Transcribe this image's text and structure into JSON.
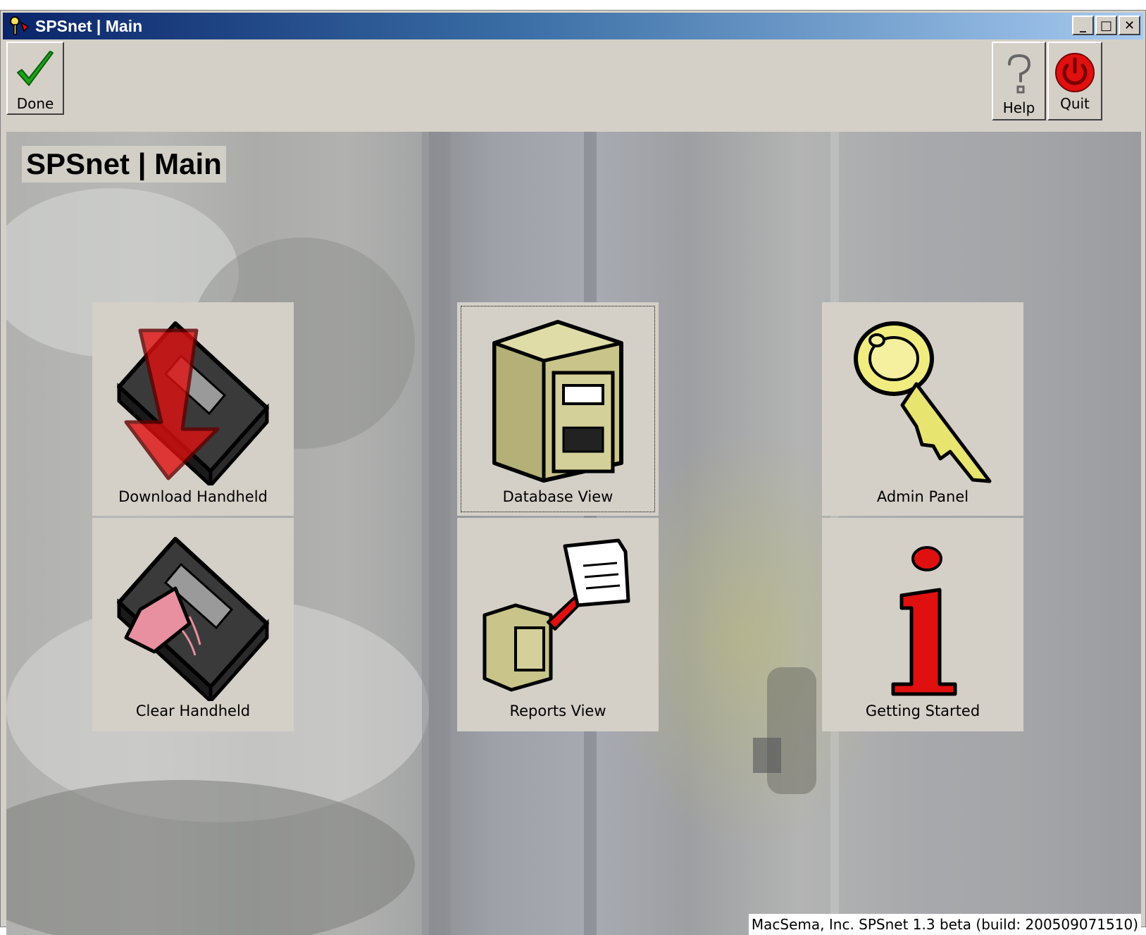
{
  "window": {
    "title": "SPSnet | Main",
    "controls": {
      "minimize": "_",
      "maximize": "□",
      "close": "✕"
    }
  },
  "toolbar": {
    "done_label": "Done",
    "help_label": "Help",
    "quit_label": "Quit"
  },
  "main": {
    "page_title": "SPSnet | Main",
    "tiles": [
      {
        "label": "Download Handheld",
        "icon": "download-handheld-icon"
      },
      {
        "label": "Clear Handheld",
        "icon": "clear-handheld-icon"
      },
      {
        "label": "Database View",
        "icon": "filing-cabinet-icon",
        "focused": true
      },
      {
        "label": "Reports View",
        "icon": "reports-icon"
      },
      {
        "label": "Admin Panel",
        "icon": "key-icon"
      },
      {
        "label": "Getting Started",
        "icon": "info-icon"
      }
    ]
  },
  "status_bar": {
    "text": "MacSema, Inc. SPSnet 1.3 beta (build: 200509071510)"
  },
  "colors": {
    "title_gradient_start": "#0a246a",
    "title_gradient_end": "#a6caf0",
    "chrome": "#d4d0c8",
    "accent_red": "#e01010",
    "checkmark_green": "#1aa31a"
  }
}
